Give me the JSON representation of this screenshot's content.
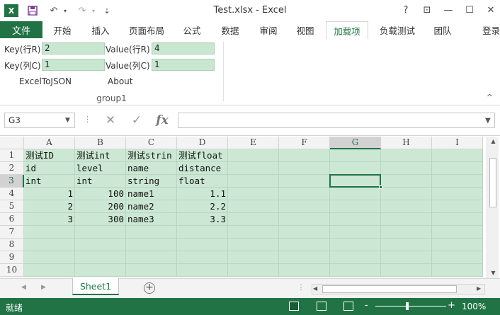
{
  "window": {
    "title": "Test.xlsx - Excel",
    "app_icon": "X",
    "help": "?",
    "restore_ribbon": "⊡",
    "minimize": "—",
    "maximize": "☐",
    "close": "✕"
  },
  "quick_access": {
    "save_icon": "save-icon",
    "undo": "↶",
    "redo": "↷",
    "customize": "⇣"
  },
  "tabs": {
    "file": "文件",
    "items": [
      "开始",
      "插入",
      "页面布局",
      "公式",
      "数据",
      "审阅",
      "视图",
      "加载项",
      "负载测试",
      "团队"
    ],
    "active": "加载项",
    "login": "登录"
  },
  "ribbon": {
    "key_row_label": "Key(行R)",
    "key_row_value": "2",
    "key_col_label": "Key(列C)",
    "key_col_value": "1",
    "value_row_label": "Value(行R)",
    "value_row_value": "4",
    "value_col_label": "Value(列C)",
    "value_col_value": "1",
    "btn_excel_to_json": "ExcelToJSON",
    "btn_about": "About",
    "group_label": "group1",
    "collapse": "^"
  },
  "formula_bar": {
    "name_box": "G3",
    "name_box_arrow": "▼",
    "dots": "⋮",
    "cancel": "✕",
    "enter": "✓",
    "fx": "fx",
    "value": "",
    "expand_arrow": "▼"
  },
  "grid": {
    "columns": [
      "A",
      "B",
      "C",
      "D",
      "E",
      "F",
      "G",
      "H",
      "I"
    ],
    "rows": [
      "1",
      "2",
      "3",
      "4",
      "5",
      "6",
      "7",
      "8",
      "9",
      "10"
    ],
    "selected_cell": "G3",
    "cells": [
      [
        "测试ID",
        "测试int",
        "测试strin",
        "测试float"
      ],
      [
        "id",
        "level",
        "name",
        "distance"
      ],
      [
        "int",
        "int",
        "string",
        "float"
      ],
      [
        "1",
        "100",
        "name1",
        "1.1"
      ],
      [
        "2",
        "200",
        "name2",
        "2.2"
      ],
      [
        "3",
        "300",
        "name3",
        "3.3"
      ]
    ]
  },
  "sheets": {
    "prev": "◀",
    "next": "▶",
    "tabs": [
      "Sheet1"
    ],
    "active": "Sheet1",
    "add": "+",
    "dots": "⋮",
    "scroll_left": "◀",
    "scroll_right": "▶",
    "scroll_up": "▲",
    "scroll_down": "▼"
  },
  "status": {
    "ready": "就绪",
    "zoom_minus": "-",
    "zoom_plus": "+",
    "zoom": "100%"
  },
  "colors": {
    "brand": "#217346",
    "cell_fill": "#cce8d4",
    "input_fill": "#c8e6d0"
  }
}
